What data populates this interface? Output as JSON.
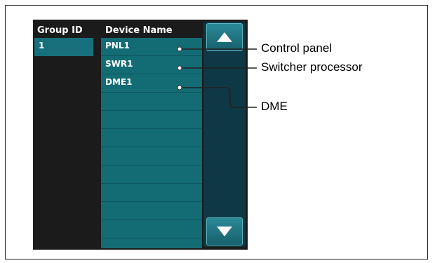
{
  "table": {
    "group_id_header": "Group ID",
    "device_name_header": "Device Name",
    "group_ids": [
      "1"
    ],
    "devices": [
      "PNL1",
      "SWR1",
      "DME1"
    ],
    "empty_rows": 8
  },
  "scroll": {
    "up_icon": "triangle-up-icon",
    "down_icon": "triangle-down-icon"
  },
  "callouts": {
    "control_panel": "Control panel",
    "switcher_processor": "Switcher processor",
    "dme": "DME"
  },
  "colors": {
    "row_teal": "#136b74",
    "panel_dark": "#1b1b1b",
    "scroll_track": "#0f3845"
  }
}
